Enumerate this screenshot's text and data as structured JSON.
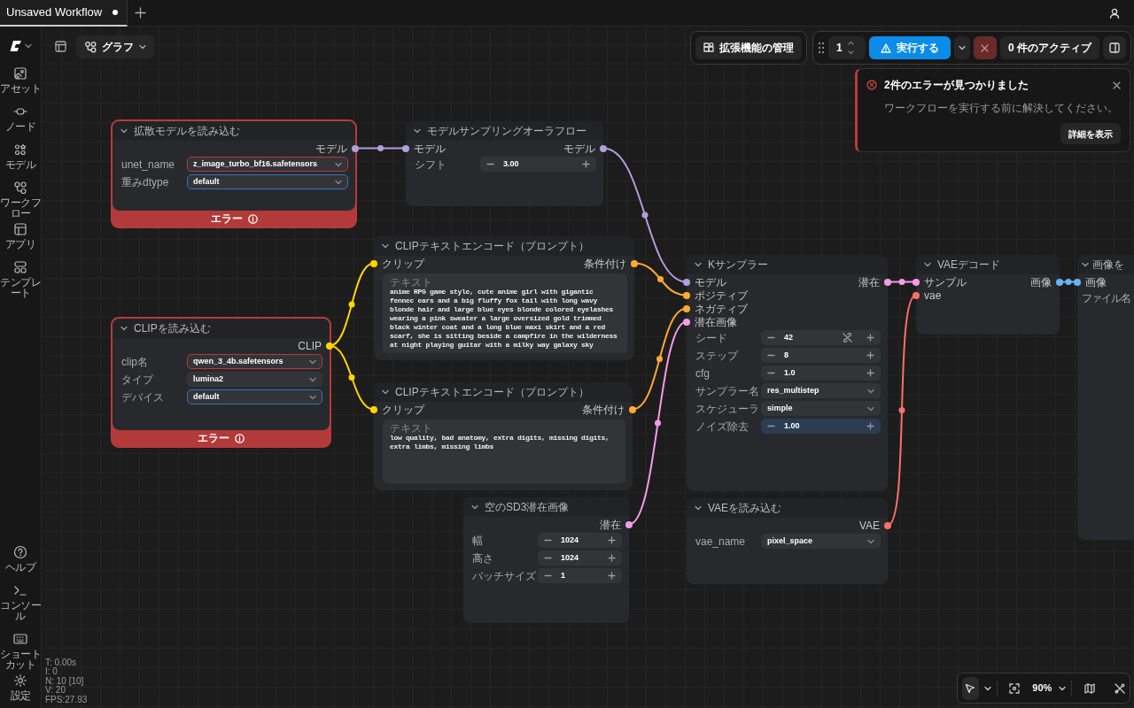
{
  "tabs": [
    {
      "label": "Unsaved Workflow",
      "selected": true,
      "modified": true
    }
  ],
  "sidebar": {
    "items": [
      {
        "label": "アセット"
      },
      {
        "label": "ノード"
      },
      {
        "label": "モデル"
      },
      {
        "label": "ワークフロー"
      },
      {
        "label": "アプリ"
      },
      {
        "label": "テンプレート"
      }
    ],
    "footer_items": [
      {
        "label": "ヘルプ"
      },
      {
        "label": "コンソール"
      },
      {
        "label": "ショートカット"
      },
      {
        "label": "設定"
      }
    ]
  },
  "view_menu": {
    "label": "グラフ"
  },
  "extensions_button": {
    "label": "拡張機能の管理"
  },
  "queue": {
    "batch_count": "1",
    "run_button": "実行する",
    "active_jobs": "0 件のアクティブ"
  },
  "error_toast": {
    "title": "2件のエラーが見つかりました",
    "message": "ワークフローを実行する前に解決してください。",
    "details_button": "詳細を表示"
  },
  "nodes": [
    {
      "title": "拡散モデルを読み込む",
      "error": true,
      "error_label": "エラー",
      "outputs": [
        {
          "label": "モデル",
          "color": "#b39ddb"
        }
      ],
      "widgets": [
        {
          "kind": "combo",
          "label": "unet_name",
          "value": "z_image_turbo_bf16.safetensors",
          "invalid": true,
          "focused": false
        },
        {
          "kind": "combo",
          "label": "重みdtype",
          "value": "default",
          "invalid": false,
          "focused": true
        }
      ]
    },
    {
      "title": "モデルサンプリングオーラフロー",
      "error": false,
      "inputs": [
        {
          "label": "モデル",
          "color": "#b39ddb"
        }
      ],
      "outputs": [
        {
          "label": "モデル",
          "color": "#b39ddb"
        }
      ],
      "widgets": [
        {
          "kind": "number",
          "label": "シフト",
          "value": "3.00",
          "highlighted": false
        }
      ]
    },
    {
      "title": "CLIPテキストエンコード（プロンプト）",
      "error": false,
      "inputs": [
        {
          "label": "クリップ",
          "color": "#ffd500"
        }
      ],
      "outputs": [
        {
          "label": "条件付け",
          "color": "#ffa931"
        }
      ],
      "widgets": [
        {
          "kind": "textarea",
          "label": "テキスト",
          "value": "anime RPG game style, cute anime girl with gigantic fennec ears and a big fluffy fox tail with long wavy blonde hair and large blue eyes blonde colored eyelashes wearing a pink sweater a large oversized gold trimmed black winter coat and a long blue maxi skirt and a red scarf, she is sitting beside a campfire in the wilderness at night playing guitar with a milky way galaxy sky"
        }
      ]
    },
    {
      "title": "CLIPを読み込む",
      "error": true,
      "error_label": "エラー",
      "outputs": [
        {
          "label": "CLIP",
          "color": "#ffd500"
        }
      ],
      "widgets": [
        {
          "kind": "combo",
          "label": "clip名",
          "value": "qwen_3_4b.safetensors",
          "invalid": true,
          "focused": false
        },
        {
          "kind": "combo",
          "label": "タイプ",
          "value": "lumina2",
          "invalid": false,
          "focused": false
        },
        {
          "kind": "combo",
          "label": "デバイス",
          "value": "default",
          "invalid": false,
          "focused": true
        }
      ]
    },
    {
      "title": "CLIPテキストエンコード（プロンプト）",
      "error": false,
      "inputs": [
        {
          "label": "クリップ",
          "color": "#ffd500"
        }
      ],
      "outputs": [
        {
          "label": "条件付け",
          "color": "#ffa931"
        }
      ],
      "widgets": [
        {
          "kind": "textarea",
          "label": "テキスト",
          "value": "low quality, bad anatomy, extra digits, missing digits, extra limbs, missing limbs"
        }
      ]
    },
    {
      "title": "空のSD3潜在画像",
      "error": false,
      "outputs": [
        {
          "label": "潜在",
          "color": "#f59be8"
        }
      ],
      "widgets": [
        {
          "kind": "number",
          "label": "幅",
          "value": "1024",
          "highlighted": false
        },
        {
          "kind": "number",
          "label": "高さ",
          "value": "1024",
          "highlighted": false
        },
        {
          "kind": "number",
          "label": "バッチサイズ",
          "value": "1",
          "highlighted": false
        }
      ]
    },
    {
      "title": "Kサンプラー",
      "error": false,
      "inputs": [
        {
          "label": "モデル",
          "color": "#b39ddb"
        },
        {
          "label": "ポジティブ",
          "color": "#ffa931"
        },
        {
          "label": "ネガティブ",
          "color": "#ffa931"
        },
        {
          "label": "潜在画像",
          "color": "#f59be8"
        }
      ],
      "outputs": [
        {
          "label": "潜在",
          "color": "#f59be8"
        }
      ],
      "widgets": [
        {
          "kind": "seed",
          "label": "シード",
          "value": "42",
          "highlighted": false
        },
        {
          "kind": "number",
          "label": "ステップ",
          "value": "8",
          "highlighted": false
        },
        {
          "kind": "number",
          "label": "cfg",
          "value": "1.0",
          "highlighted": false
        },
        {
          "kind": "combo",
          "label": "サンプラー名",
          "value": "res_multistep",
          "invalid": false,
          "focused": false
        },
        {
          "kind": "combo",
          "label": "スケジューラ",
          "value": "simple",
          "invalid": false,
          "focused": false
        },
        {
          "kind": "number",
          "label": "ノイズ除去",
          "value": "1.00",
          "highlighted": true
        }
      ]
    },
    {
      "title": "VAEを読み込む",
      "error": false,
      "outputs": [
        {
          "label": "VAE",
          "color": "#ff6e6e"
        }
      ],
      "widgets": [
        {
          "kind": "combo",
          "label": "vae_name",
          "value": "pixel_space",
          "invalid": false,
          "focused": false
        }
      ]
    },
    {
      "title": "VAEデコード",
      "error": false,
      "inputs": [
        {
          "label": "サンプル",
          "color": "#f59be8"
        },
        {
          "label": "vae",
          "color": "#ff6e6e"
        }
      ],
      "outputs": [
        {
          "label": "画像",
          "color": "#64b5f6"
        }
      ]
    },
    {
      "title": "画像を",
      "error": false,
      "inputs": [
        {
          "label": "画像",
          "color": "#64b5f6"
        }
      ],
      "widgets": [
        {
          "kind": "string",
          "label": "ファイル名"
        }
      ]
    }
  ],
  "stats": [
    "T: 0.00s",
    "I: 0",
    "N: 10 [10]",
    "V: 20",
    "FPS:27.93"
  ],
  "canvas_toolbar": {
    "zoom": "90%"
  }
}
